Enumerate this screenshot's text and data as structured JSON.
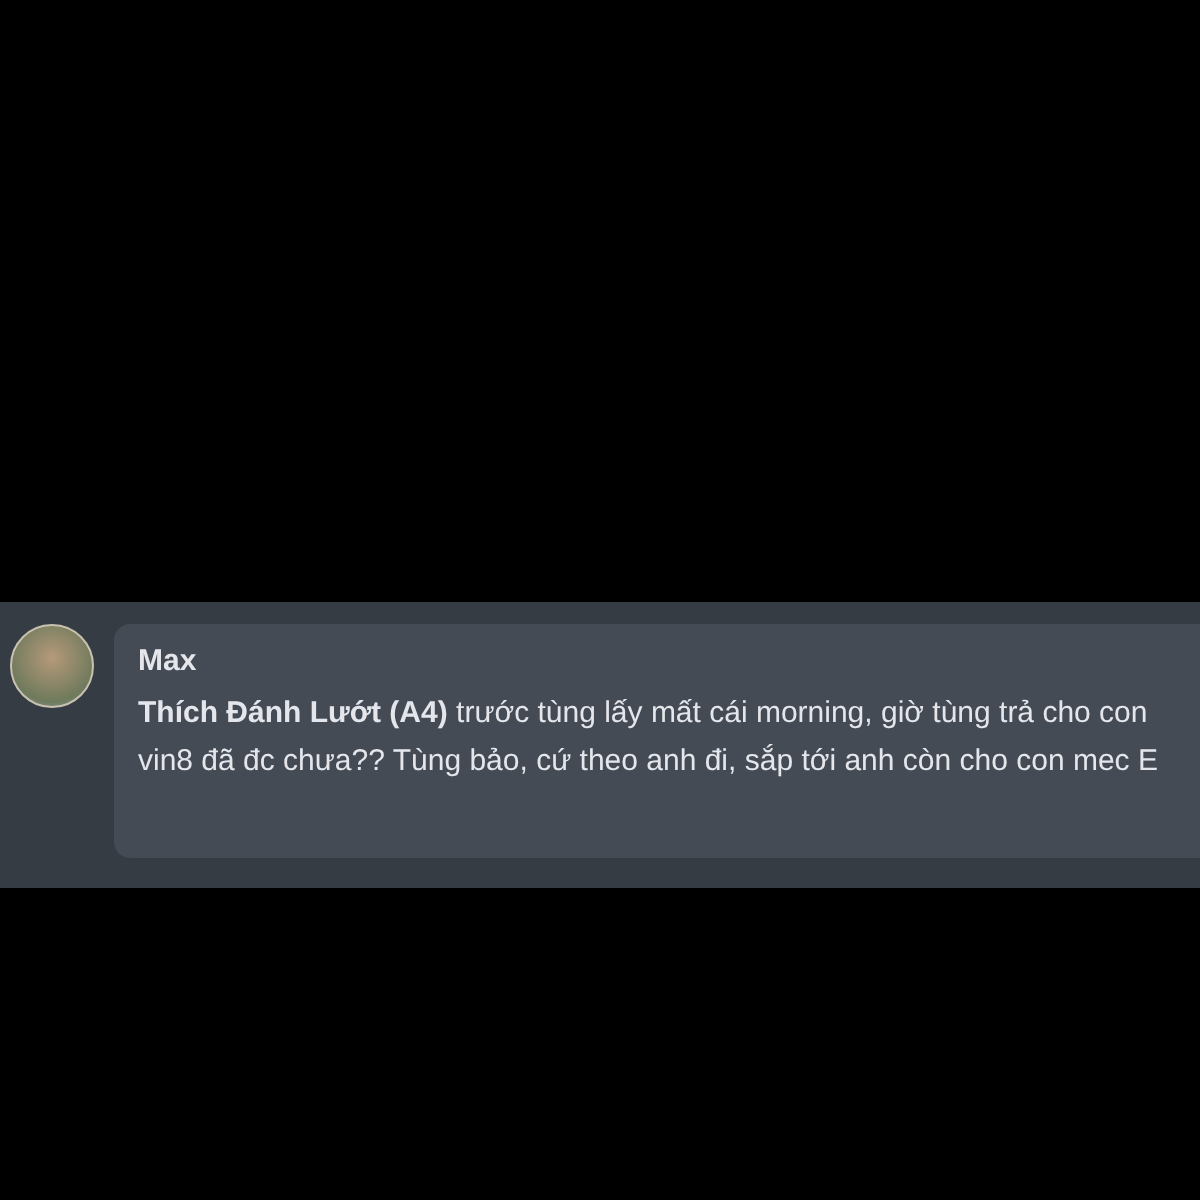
{
  "comment": {
    "author": "Max",
    "text": "**Thích Đánh Lướt (A4)** trước tùng lấy mất cái morning, giờ tùng trả cho con vin8 đã đc chưa?? Tùng bảo, cứ theo anh đi, sắp tới anh còn cho con mec E"
  }
}
